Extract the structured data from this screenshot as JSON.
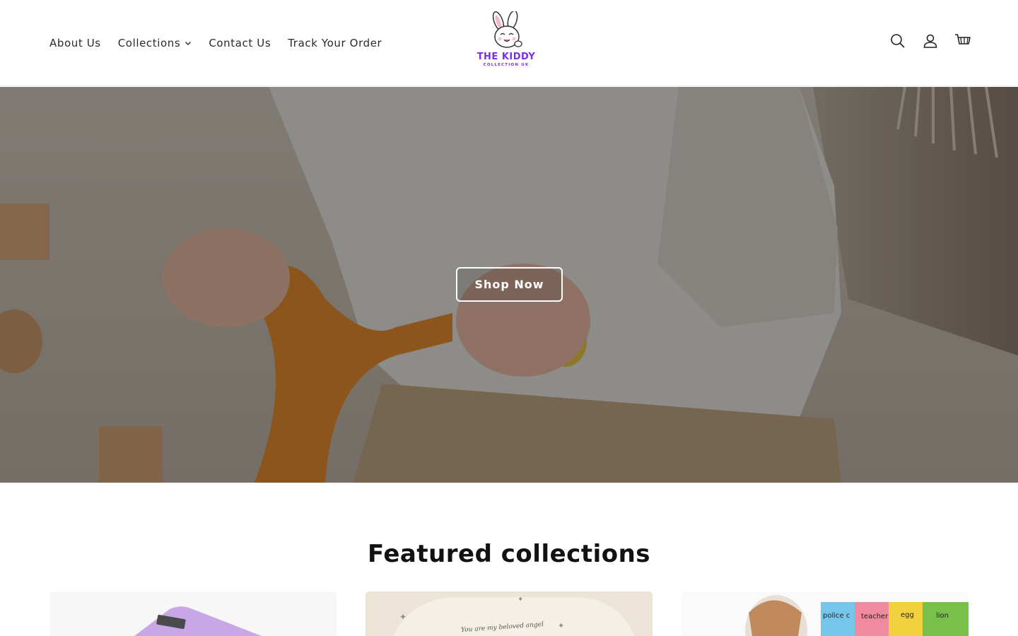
{
  "header": {
    "nav": [
      {
        "label": "About Us"
      },
      {
        "label": "Collections",
        "has_dropdown": true
      },
      {
        "label": "Contact Us"
      },
      {
        "label": "Track Your Order"
      }
    ],
    "logo": {
      "main": "THE KIDDY",
      "sub": "COLLECTION UK"
    },
    "icons": [
      "search-icon",
      "account-icon",
      "cart-icon"
    ]
  },
  "hero": {
    "button_label": "Shop Now"
  },
  "featured": {
    "title": "Featured collections",
    "cards": [
      {
        "name": "collection-card-1"
      },
      {
        "name": "collection-card-2",
        "caption": "You are my beloved angel"
      },
      {
        "name": "collection-card-3",
        "tags": [
          "police c",
          "teacher",
          "egg",
          "lion"
        ]
      }
    ]
  },
  "colors": {
    "brand": "#7a2ff0",
    "text": "#121212",
    "hero_overlay": "rgba(0,0,0,0.38)"
  }
}
